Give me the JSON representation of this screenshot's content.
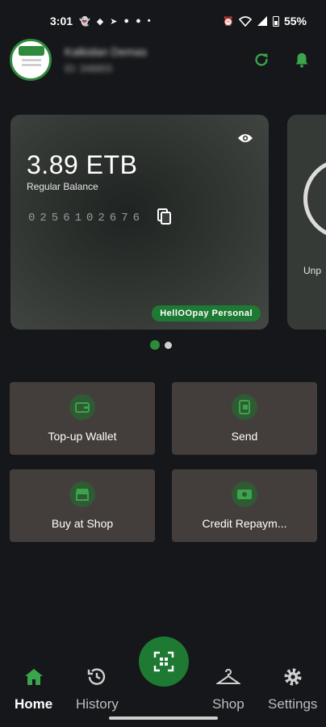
{
  "status_bar": {
    "time": "3:01",
    "battery": "55%",
    "left_icons": [
      "snapchat-icon",
      "bird-icon",
      "telegram-icon",
      "chat-icon",
      "facebook-icon",
      "dot-icon"
    ],
    "right_icons": [
      "alarm-icon",
      "wifi-icon",
      "signal-icon",
      "battery-icon"
    ]
  },
  "header": {
    "user_name": "Kalkidan Demas",
    "user_id": "ID: 348803",
    "accent_color": "#3aa54a"
  },
  "balance_card": {
    "amount": "3.89 ETB",
    "label": "Regular Balance",
    "account_number": "0256102676",
    "account_type_badge": "HellOOpay Personal"
  },
  "next_card": {
    "label": "Unp"
  },
  "carousel": {
    "pages": 2,
    "active_index": 0
  },
  "actions": [
    {
      "label": "Top-up Wallet",
      "icon": "wallet-icon"
    },
    {
      "label": "Send",
      "icon": "send-icon"
    },
    {
      "label": "Buy at Shop",
      "icon": "store-icon"
    },
    {
      "label": "Credit Repaym...",
      "icon": "money-icon"
    }
  ],
  "bottom_nav": {
    "items": [
      {
        "label": "Home",
        "icon": "home-icon",
        "active": true
      },
      {
        "label": "History",
        "icon": "history-icon",
        "active": false
      },
      {
        "label": "Shop",
        "icon": "hanger-icon",
        "active": false
      },
      {
        "label": "Settings",
        "icon": "gear-icon",
        "active": false
      }
    ],
    "fab_icon": "qr-scan-icon"
  },
  "colors": {
    "background": "#16171a",
    "brand_green": "#1e7a33",
    "tile_bg": "#433e3b"
  }
}
